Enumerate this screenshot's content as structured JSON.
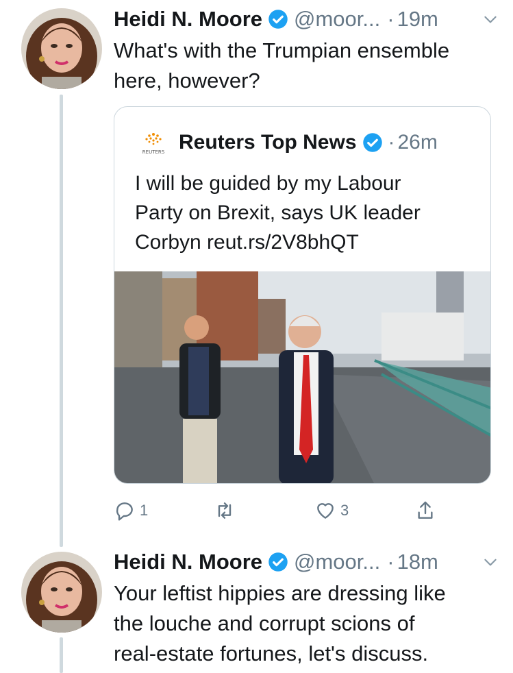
{
  "tweet1": {
    "author_name": "Heidi N. Moore",
    "handle": "@moor...",
    "separator": "·",
    "time": "19m",
    "text_lines": [
      "What's with the Trumpian ensemble",
      "here, however?"
    ],
    "avatar_icon": "avatar-woman-photo"
  },
  "quote": {
    "logo_text": "REUTERS",
    "author_name": "Reuters Top News",
    "separator": "·",
    "time": "26m",
    "text_lines": [
      "I will be guided by my Labour",
      "Party on Brexit, says UK leader",
      "Corbyn reut.rs/2V8bhQT"
    ],
    "image_icon": "news-photo-seafront"
  },
  "actions": {
    "reply_count": "1",
    "retweet_count": "",
    "like_count": "3"
  },
  "tweet2": {
    "author_name": "Heidi N. Moore",
    "handle": "@moor...",
    "separator": "·",
    "time": "18m",
    "text_lines": [
      "Your leftist hippies are dressing like",
      "the louche and corrupt scions of",
      "real-estate fortunes, let's discuss."
    ],
    "avatar_icon": "avatar-woman-photo"
  },
  "colors": {
    "text": "#14171a",
    "muted": "#657786",
    "verified_blue": "#1da1f2",
    "thread_line": "#cfd9de",
    "card_border": "#ccd6dd"
  }
}
